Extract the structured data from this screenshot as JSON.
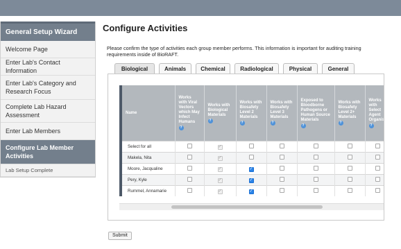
{
  "sidebar": {
    "header": "General Setup Wizard",
    "items": [
      {
        "label": "Welcome Page"
      },
      {
        "label": "Enter Lab's Contact Information"
      },
      {
        "label": "Enter Lab's Category and Research Focus"
      },
      {
        "label": "Complete Lab Hazard Assessment"
      },
      {
        "label": "Enter Lab Members"
      },
      {
        "label": "Configure Lab Member Activities",
        "active": true
      },
      {
        "label": "Lab Setup Complete"
      }
    ]
  },
  "main": {
    "title": "Configure Activities",
    "intro": "Please confirm the type of activities each group member performs. This information is important for auditing training requirements inside of BioRAFT.",
    "tabs": [
      "Biological",
      "Animals",
      "Chemical",
      "Radiological",
      "Physical",
      "General"
    ],
    "active_tab": "Biological",
    "table": {
      "name_header": "Name",
      "columns": [
        "Works with Viral Vectors which May Infect Humans",
        "Works with Biological Materials",
        "Works with Biosafety Level 2 Materials",
        "Works with Biosafety Level 3 Materials",
        "Exposed to Bloodborne Pathogens or Human Source Materials",
        "Works with Biosafety Level 2+ Materials",
        "Works with Select Agent Organisms"
      ],
      "rows": [
        {
          "name": "Select for all",
          "checks": [
            "unchecked",
            "disabled",
            "unchecked",
            "unchecked",
            "unchecked",
            "unchecked",
            "unchecked"
          ]
        },
        {
          "name": "Makela, Nita",
          "checks": [
            "unchecked",
            "disabled",
            "unchecked",
            "unchecked",
            "unchecked",
            "unchecked",
            "unchecked"
          ]
        },
        {
          "name": "Moore, Jacqualine",
          "checks": [
            "unchecked",
            "disabled",
            "checked",
            "unchecked",
            "unchecked",
            "unchecked",
            "unchecked"
          ]
        },
        {
          "name": "Pery, Kyle",
          "checks": [
            "unchecked",
            "disabled",
            "checked",
            "unchecked",
            "unchecked",
            "unchecked",
            "unchecked"
          ]
        },
        {
          "name": "Rummel, Annamarie",
          "checks": [
            "unchecked",
            "disabled",
            "checked",
            "unchecked",
            "unchecked",
            "unchecked",
            "unchecked"
          ]
        }
      ]
    },
    "submit_label": "Submit"
  },
  "colors": {
    "topbar": "#7d8a99",
    "sidebar_active": "#737f8c",
    "header_cells": "#b3b8bd",
    "checkbox_checked": "#2b84e8"
  }
}
